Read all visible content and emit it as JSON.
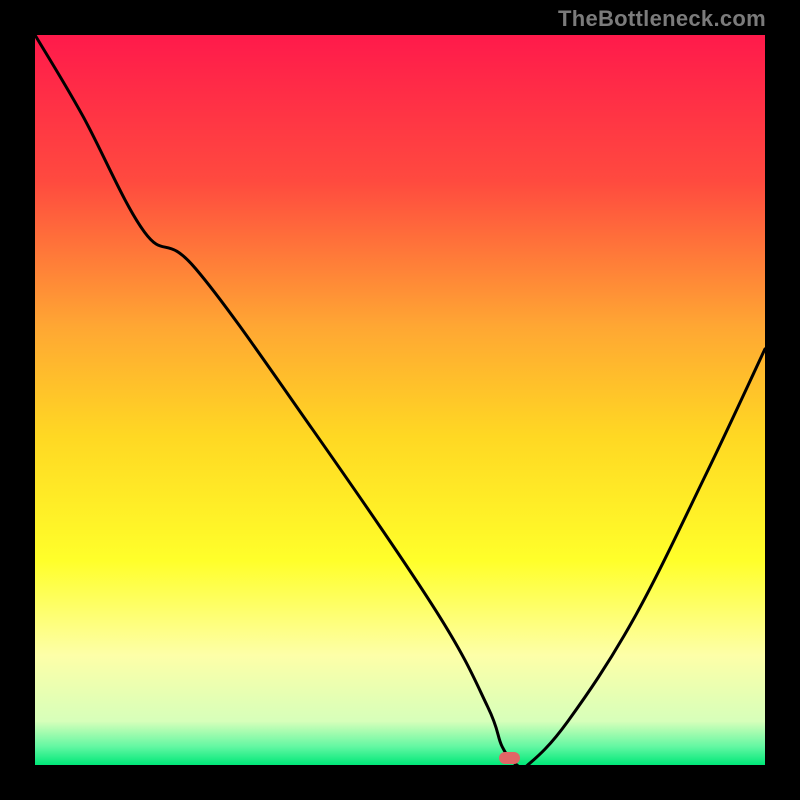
{
  "watermark": {
    "text": "TheBottleneck.com"
  },
  "chart_data": {
    "type": "line",
    "title": "",
    "xlabel": "",
    "ylabel": "",
    "xlim": [
      0,
      100
    ],
    "ylim": [
      0,
      100
    ],
    "gradient_bands": [
      {
        "stop": 0.0,
        "color": "#ff1a4b"
      },
      {
        "stop": 0.2,
        "color": "#ff4a3f"
      },
      {
        "stop": 0.4,
        "color": "#ffa733"
      },
      {
        "stop": 0.55,
        "color": "#ffd823"
      },
      {
        "stop": 0.72,
        "color": "#ffff2a"
      },
      {
        "stop": 0.85,
        "color": "#fdffa8"
      },
      {
        "stop": 0.94,
        "color": "#d7ffba"
      },
      {
        "stop": 0.975,
        "color": "#62f7a2"
      },
      {
        "stop": 1.0,
        "color": "#00e878"
      }
    ],
    "series": [
      {
        "name": "bottleneck-curve",
        "x": [
          0.0,
          6.5,
          15.0,
          22.0,
          38.0,
          55.0,
          62.0,
          64.0,
          66.0,
          67.5,
          73.0,
          82.0,
          92.0,
          100.0
        ],
        "y": [
          100.0,
          89.0,
          73.0,
          68.0,
          46.0,
          21.0,
          8.0,
          2.5,
          0.0,
          0.0,
          6.0,
          20.0,
          40.0,
          57.0
        ]
      }
    ],
    "marker": {
      "name": "optimal-point",
      "x_range": [
        63.5,
        66.5
      ],
      "y": 0,
      "height_pct": 1.6,
      "color": "#e06666"
    }
  }
}
